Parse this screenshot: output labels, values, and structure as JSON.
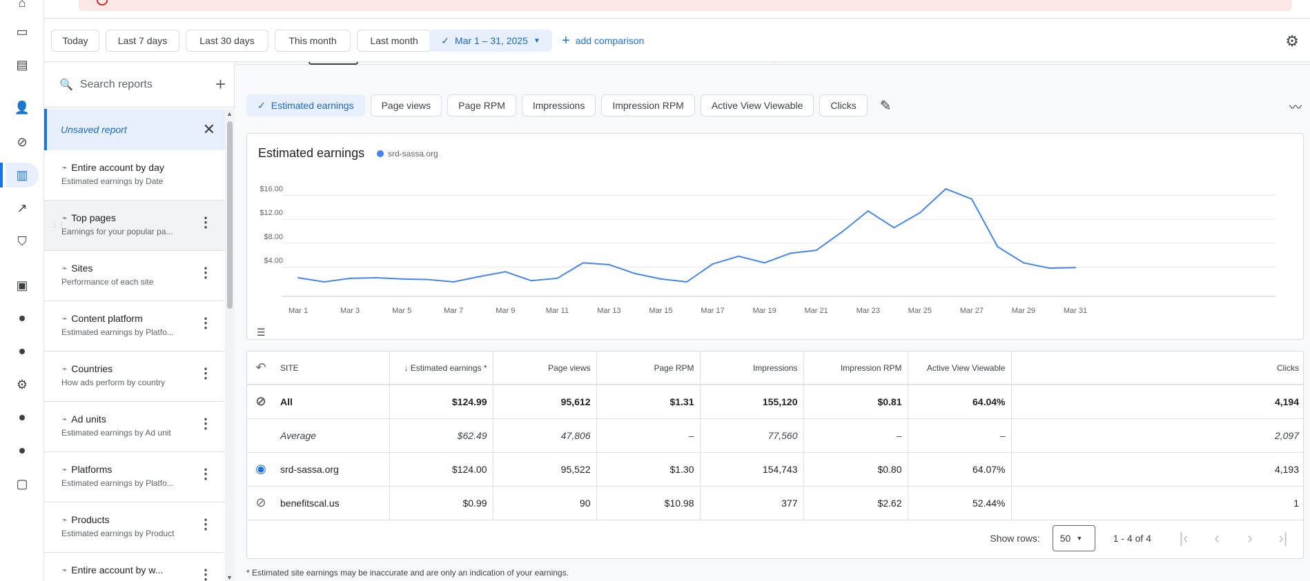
{
  "datebar": {
    "chips": [
      "Today",
      "Last 7 days",
      "Last 30 days",
      "This month",
      "Last month"
    ],
    "selected_range": "Mar 1 – 31, 2025",
    "add_comparison": "add comparison"
  },
  "sidebar": {
    "search_placeholder": "Search reports",
    "unsaved": "Unsaved report",
    "items": [
      {
        "title": "Entire account by day",
        "subtitle": "Estimated earnings by Date"
      },
      {
        "title": "Top pages",
        "subtitle": "Earnings for your popular pa..."
      },
      {
        "title": "Sites",
        "subtitle": "Performance of each site"
      },
      {
        "title": "Content platform",
        "subtitle": "Estimated earnings by Platfo..."
      },
      {
        "title": "Countries",
        "subtitle": "How ads perform by country"
      },
      {
        "title": "Ad units",
        "subtitle": "Estimated earnings by Ad unit"
      },
      {
        "title": "Platforms",
        "subtitle": "Estimated earnings by Platfo..."
      },
      {
        "title": "Products",
        "subtitle": "Estimated earnings by Product"
      },
      {
        "title": "Entire account by w...",
        "subtitle": ""
      }
    ]
  },
  "metrics": [
    "Estimated earnings",
    "Page views",
    "Page RPM",
    "Impressions",
    "Impression RPM",
    "Active View Viewable",
    "Clicks"
  ],
  "chart_data": {
    "type": "line",
    "title": "Estimated earnings",
    "series": [
      {
        "name": "srd-sassa.org",
        "color": "#4285f4",
        "values": [
          2.2,
          1.5,
          2.1,
          2.2,
          2.0,
          1.9,
          1.5,
          2.4,
          3.2,
          1.7,
          2.1,
          4.7,
          4.4,
          2.9,
          2.0,
          1.5,
          4.5,
          5.8,
          4.7,
          6.3,
          6.8,
          9.9,
          13.4,
          10.6,
          13.1,
          17.1,
          15.4,
          7.4,
          4.7,
          3.8,
          3.9
        ]
      }
    ],
    "x": [
      "Mar 1",
      "Mar 2",
      "Mar 3",
      "Mar 4",
      "Mar 5",
      "Mar 6",
      "Mar 7",
      "Mar 8",
      "Mar 9",
      "Mar 10",
      "Mar 11",
      "Mar 12",
      "Mar 13",
      "Mar 14",
      "Mar 15",
      "Mar 16",
      "Mar 17",
      "Mar 18",
      "Mar 19",
      "Mar 20",
      "Mar 21",
      "Mar 22",
      "Mar 23",
      "Mar 24",
      "Mar 25",
      "Mar 26",
      "Mar 27",
      "Mar 28",
      "Mar 29",
      "Mar 30",
      "Mar 31"
    ],
    "xticks": [
      "Mar 1",
      "Mar 3",
      "Mar 5",
      "Mar 7",
      "Mar 9",
      "Mar 11",
      "Mar 13",
      "Mar 15",
      "Mar 17",
      "Mar 19",
      "Mar 21",
      "Mar 23",
      "Mar 25",
      "Mar 27",
      "Mar 29",
      "Mar 31"
    ],
    "yticks": [
      "$4.00",
      "$8.00",
      "$12.00",
      "$16.00"
    ],
    "ylim": [
      0,
      20
    ],
    "grid": true
  },
  "table": {
    "headers": [
      "SITE",
      "Estimated earnings *",
      "Page views",
      "Page RPM",
      "Impressions",
      "Impression RPM",
      "Active View Viewable",
      "Clicks"
    ],
    "rows": [
      {
        "kind": "all",
        "site": "All",
        "vals": [
          "$124.99",
          "95,612",
          "$1.31",
          "155,120",
          "$0.81",
          "64.04%",
          "4,194"
        ]
      },
      {
        "kind": "avg",
        "site": "Average",
        "vals": [
          "$62.49",
          "47,806",
          "–",
          "77,560",
          "–",
          "–",
          "2,097"
        ]
      },
      {
        "kind": "row",
        "site": "srd-sassa.org",
        "vals": [
          "$124.00",
          "95,522",
          "$1.30",
          "154,743",
          "$0.80",
          "64.07%",
          "4,193"
        ]
      },
      {
        "kind": "row",
        "site": "benefitscal.us",
        "vals": [
          "$0.99",
          "90",
          "$10.98",
          "377",
          "$2.62",
          "52.44%",
          "1"
        ]
      }
    ]
  },
  "pager": {
    "show_rows_label": "Show rows:",
    "rows": "50",
    "range": "1 - 4 of 4"
  },
  "footnote": "* Estimated site earnings may be inaccurate and are only an indication of your earnings."
}
